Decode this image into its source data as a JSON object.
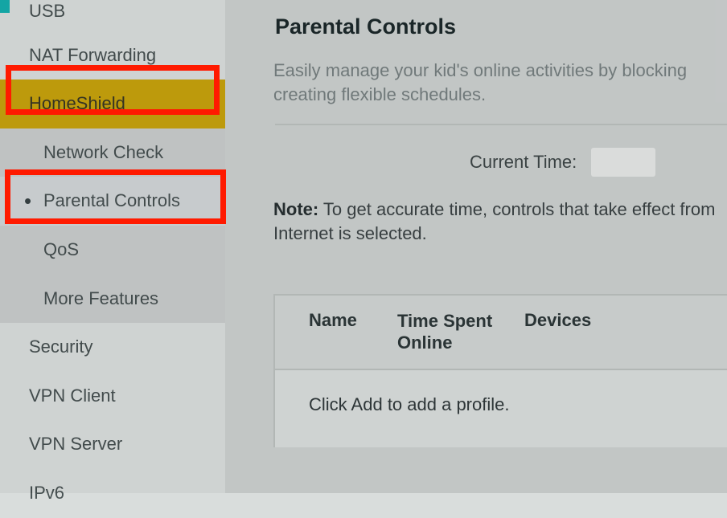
{
  "sidebar": {
    "items": [
      {
        "label": "USB"
      },
      {
        "label": "NAT Forwarding"
      },
      {
        "label": "HomeShield"
      },
      {
        "label": "Network Check"
      },
      {
        "label": "Parental Controls"
      },
      {
        "label": "QoS"
      },
      {
        "label": "More Features"
      },
      {
        "label": "Security"
      },
      {
        "label": "VPN Client"
      },
      {
        "label": "VPN Server"
      },
      {
        "label": "IPv6"
      }
    ]
  },
  "main": {
    "title": "Parental Controls",
    "description": "Easily manage your kid's online activities by blocking creating flexible schedules.",
    "current_time_label": "Current Time:",
    "current_time_value": "",
    "note_label": "Note:",
    "note_text": " To get accurate time, controls that take effect from Internet is selected.",
    "table": {
      "headers": {
        "name": "Name",
        "time": "Time Spent Online",
        "devices": "Devices"
      },
      "empty_text": "Click Add to add a profile."
    }
  }
}
